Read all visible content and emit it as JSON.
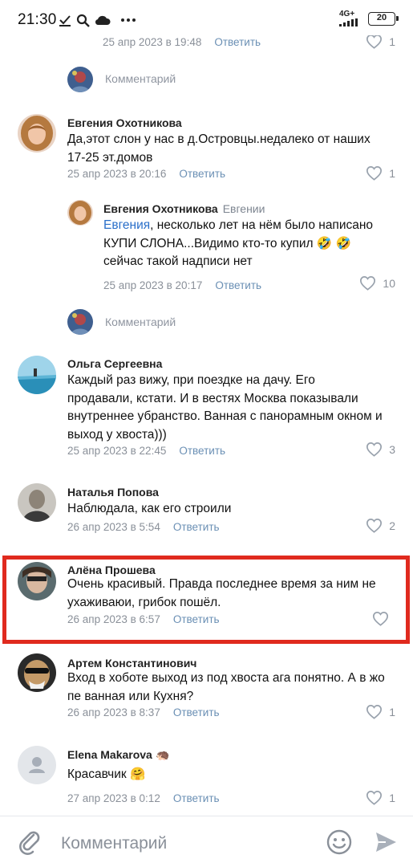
{
  "status_bar": {
    "time": "21:30",
    "network": "4G+",
    "battery": "20",
    "icons": [
      "download-check-icon",
      "search-icon",
      "cloud-icon",
      "more-dots-icon",
      "signal-icon",
      "battery-icon"
    ]
  },
  "top_partial": {
    "date": "25 апр 2023 в 19:48",
    "reply_label": "Ответить",
    "likes": "1"
  },
  "comment_prompt_1": "Комментарий",
  "comment_prompt_2": "Комментарий",
  "comments": [
    {
      "name": "Евгения Охотникова",
      "lines": [
        "Да,этот слон у нас в д.Островцы.недалеко от наших",
        "17-25 эт.домов"
      ],
      "date": "25 апр 2023 в 20:16",
      "reply_label": "Ответить",
      "likes": "1"
    },
    {
      "name": "Евгения Охотникова",
      "reply_to": "Евгении",
      "mention": "Евгения",
      "line1_rest": ", несколько лет на нём было написано",
      "line2": "КУПИ СЛОНА...Видимо кто-то купил",
      "emoji2": "🤣 🤣",
      "line3": "сейчас такой надписи нет",
      "date": "25 апр 2023 в 20:17",
      "reply_label": "Ответить",
      "likes": "10"
    },
    {
      "name": "Ольга Сергеевна",
      "lines": [
        "Каждый раз вижу, при поездке на дачу. Его",
        "продавали, кстати. И в вестях Москва показывали",
        "внутреннее убранство. Ванная с панорамным окном и",
        "выход у хвоста)))"
      ],
      "date": "25 апр 2023 в 22:45",
      "reply_label": "Ответить",
      "likes": "3"
    },
    {
      "name": "Наталья Попова",
      "lines": [
        "Наблюдала, как его строили"
      ],
      "date": "26 апр 2023 в 5:54",
      "reply_label": "Ответить",
      "likes": "2"
    },
    {
      "name": "Алёна Прошева",
      "lines": [
        "Очень красивый. Правда последнее время за ним не",
        "ухаживаюи, грибок пошёл."
      ],
      "date": "26 апр 2023 в 6:57",
      "reply_label": "Ответить",
      "likes": ""
    },
    {
      "name": "Артем Константинович",
      "lines": [
        "Вход в хоботе выход из под хвоста ага понятно. А в жо",
        "пе ванная или Кухня?"
      ],
      "date": "26 апр 2023 в 8:37",
      "reply_label": "Ответить",
      "likes": "1"
    },
    {
      "name": "Elena Makarova",
      "name_emoji": "🦔",
      "lines": [
        "Красавчик"
      ],
      "text_emoji": "🤗",
      "date": "27 апр 2023 в 0:12",
      "reply_label": "Ответить",
      "likes": "1"
    }
  ],
  "input_bar": {
    "placeholder": "Комментарий",
    "icons": [
      "paperclip-icon",
      "emoji-icon",
      "send-icon"
    ]
  },
  "colors": {
    "highlight": "#e02a1e",
    "link": "#2a6fc9",
    "muted": "#8a9099"
  }
}
